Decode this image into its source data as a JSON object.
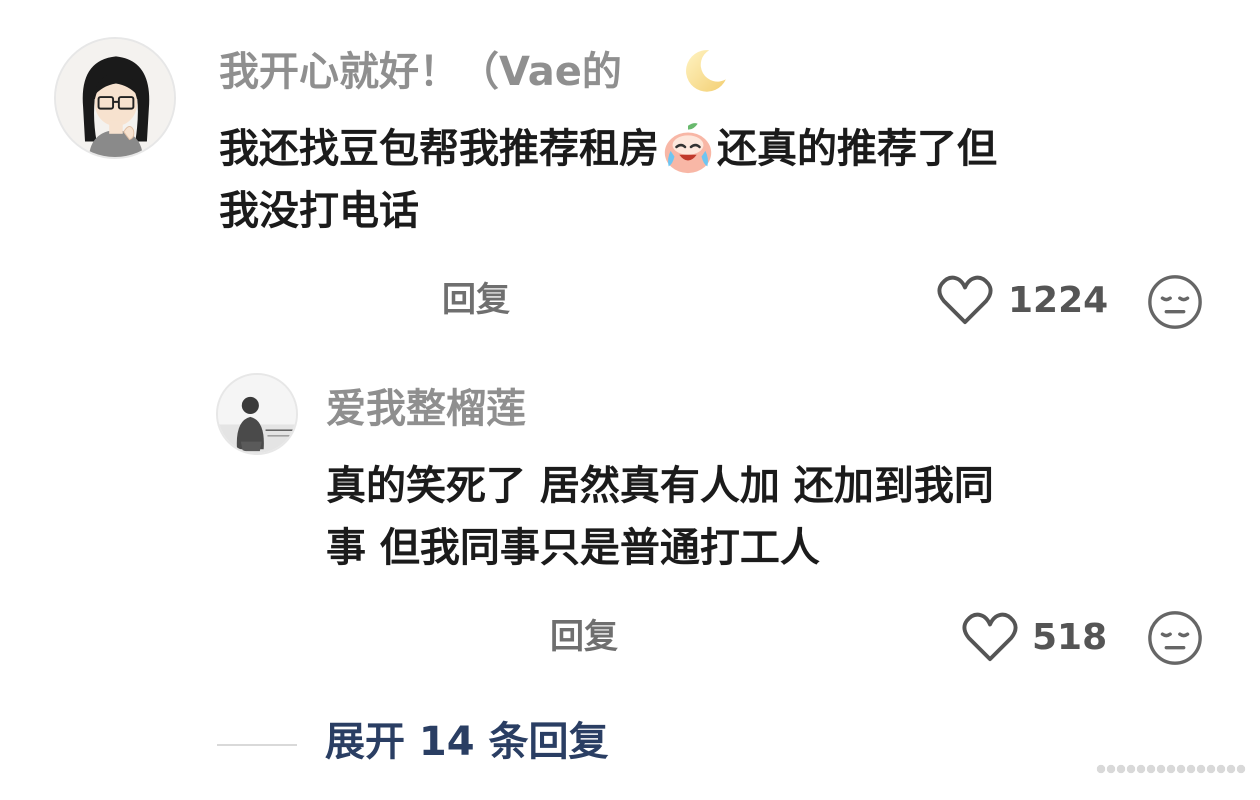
{
  "comments": [
    {
      "username": "我开心就好！（Vae的",
      "username_emoji": "crescent-moon",
      "text_line1_a": "我还找豆包帮我推荐租房",
      "inline_emoji": "doubao-crying-laughing-emoji",
      "text_line1_b": "还真的推荐了但",
      "text_line2": "我没打电话",
      "reply_label": "回复",
      "like_count": "1224"
    }
  ],
  "reply": {
    "username": "爱我整榴莲",
    "text_line1": "真的笑死了 居然真有人加 还加到我同",
    "text_line2": "事 但我同事只是普通打工人",
    "reply_label": "回复",
    "like_count": "518"
  },
  "expand_label": "展开 14 条回复",
  "colors": {
    "username": "#8f8f8f",
    "text": "#1b1b1b",
    "expand_link": "#2a3e63"
  }
}
